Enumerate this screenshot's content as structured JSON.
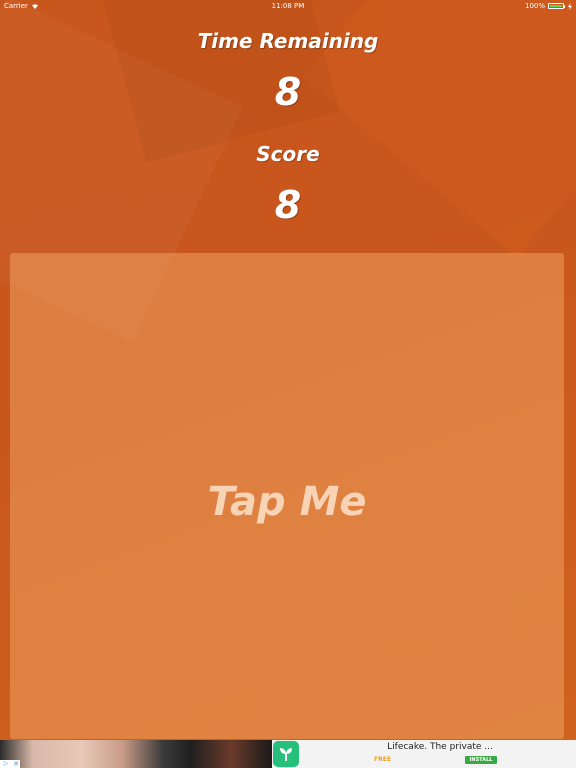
{
  "status_bar": {
    "carrier": "Carrier",
    "time": "11:08 PM",
    "battery": "100%",
    "wifi_icon": "wifi-icon",
    "battery_icon": "battery-icon",
    "charging_icon": "charging-icon"
  },
  "game": {
    "time_label": "Time Remaining",
    "time_value": "8",
    "score_label": "Score",
    "score_value": "8",
    "tap_button_label": "Tap Me"
  },
  "ad": {
    "info_icon": "info-icon",
    "close_icon": "close-icon",
    "app_icon": "lifecake-app-icon",
    "title": "Lifecake. The private ...",
    "price": "FREE",
    "install_label": "INSTALL"
  },
  "colors": {
    "background": "#c4541b",
    "tap_area": "#e08848",
    "tap_text": "#f8d3b6",
    "ad_icon": "#27c07a",
    "install": "#3aa845"
  }
}
